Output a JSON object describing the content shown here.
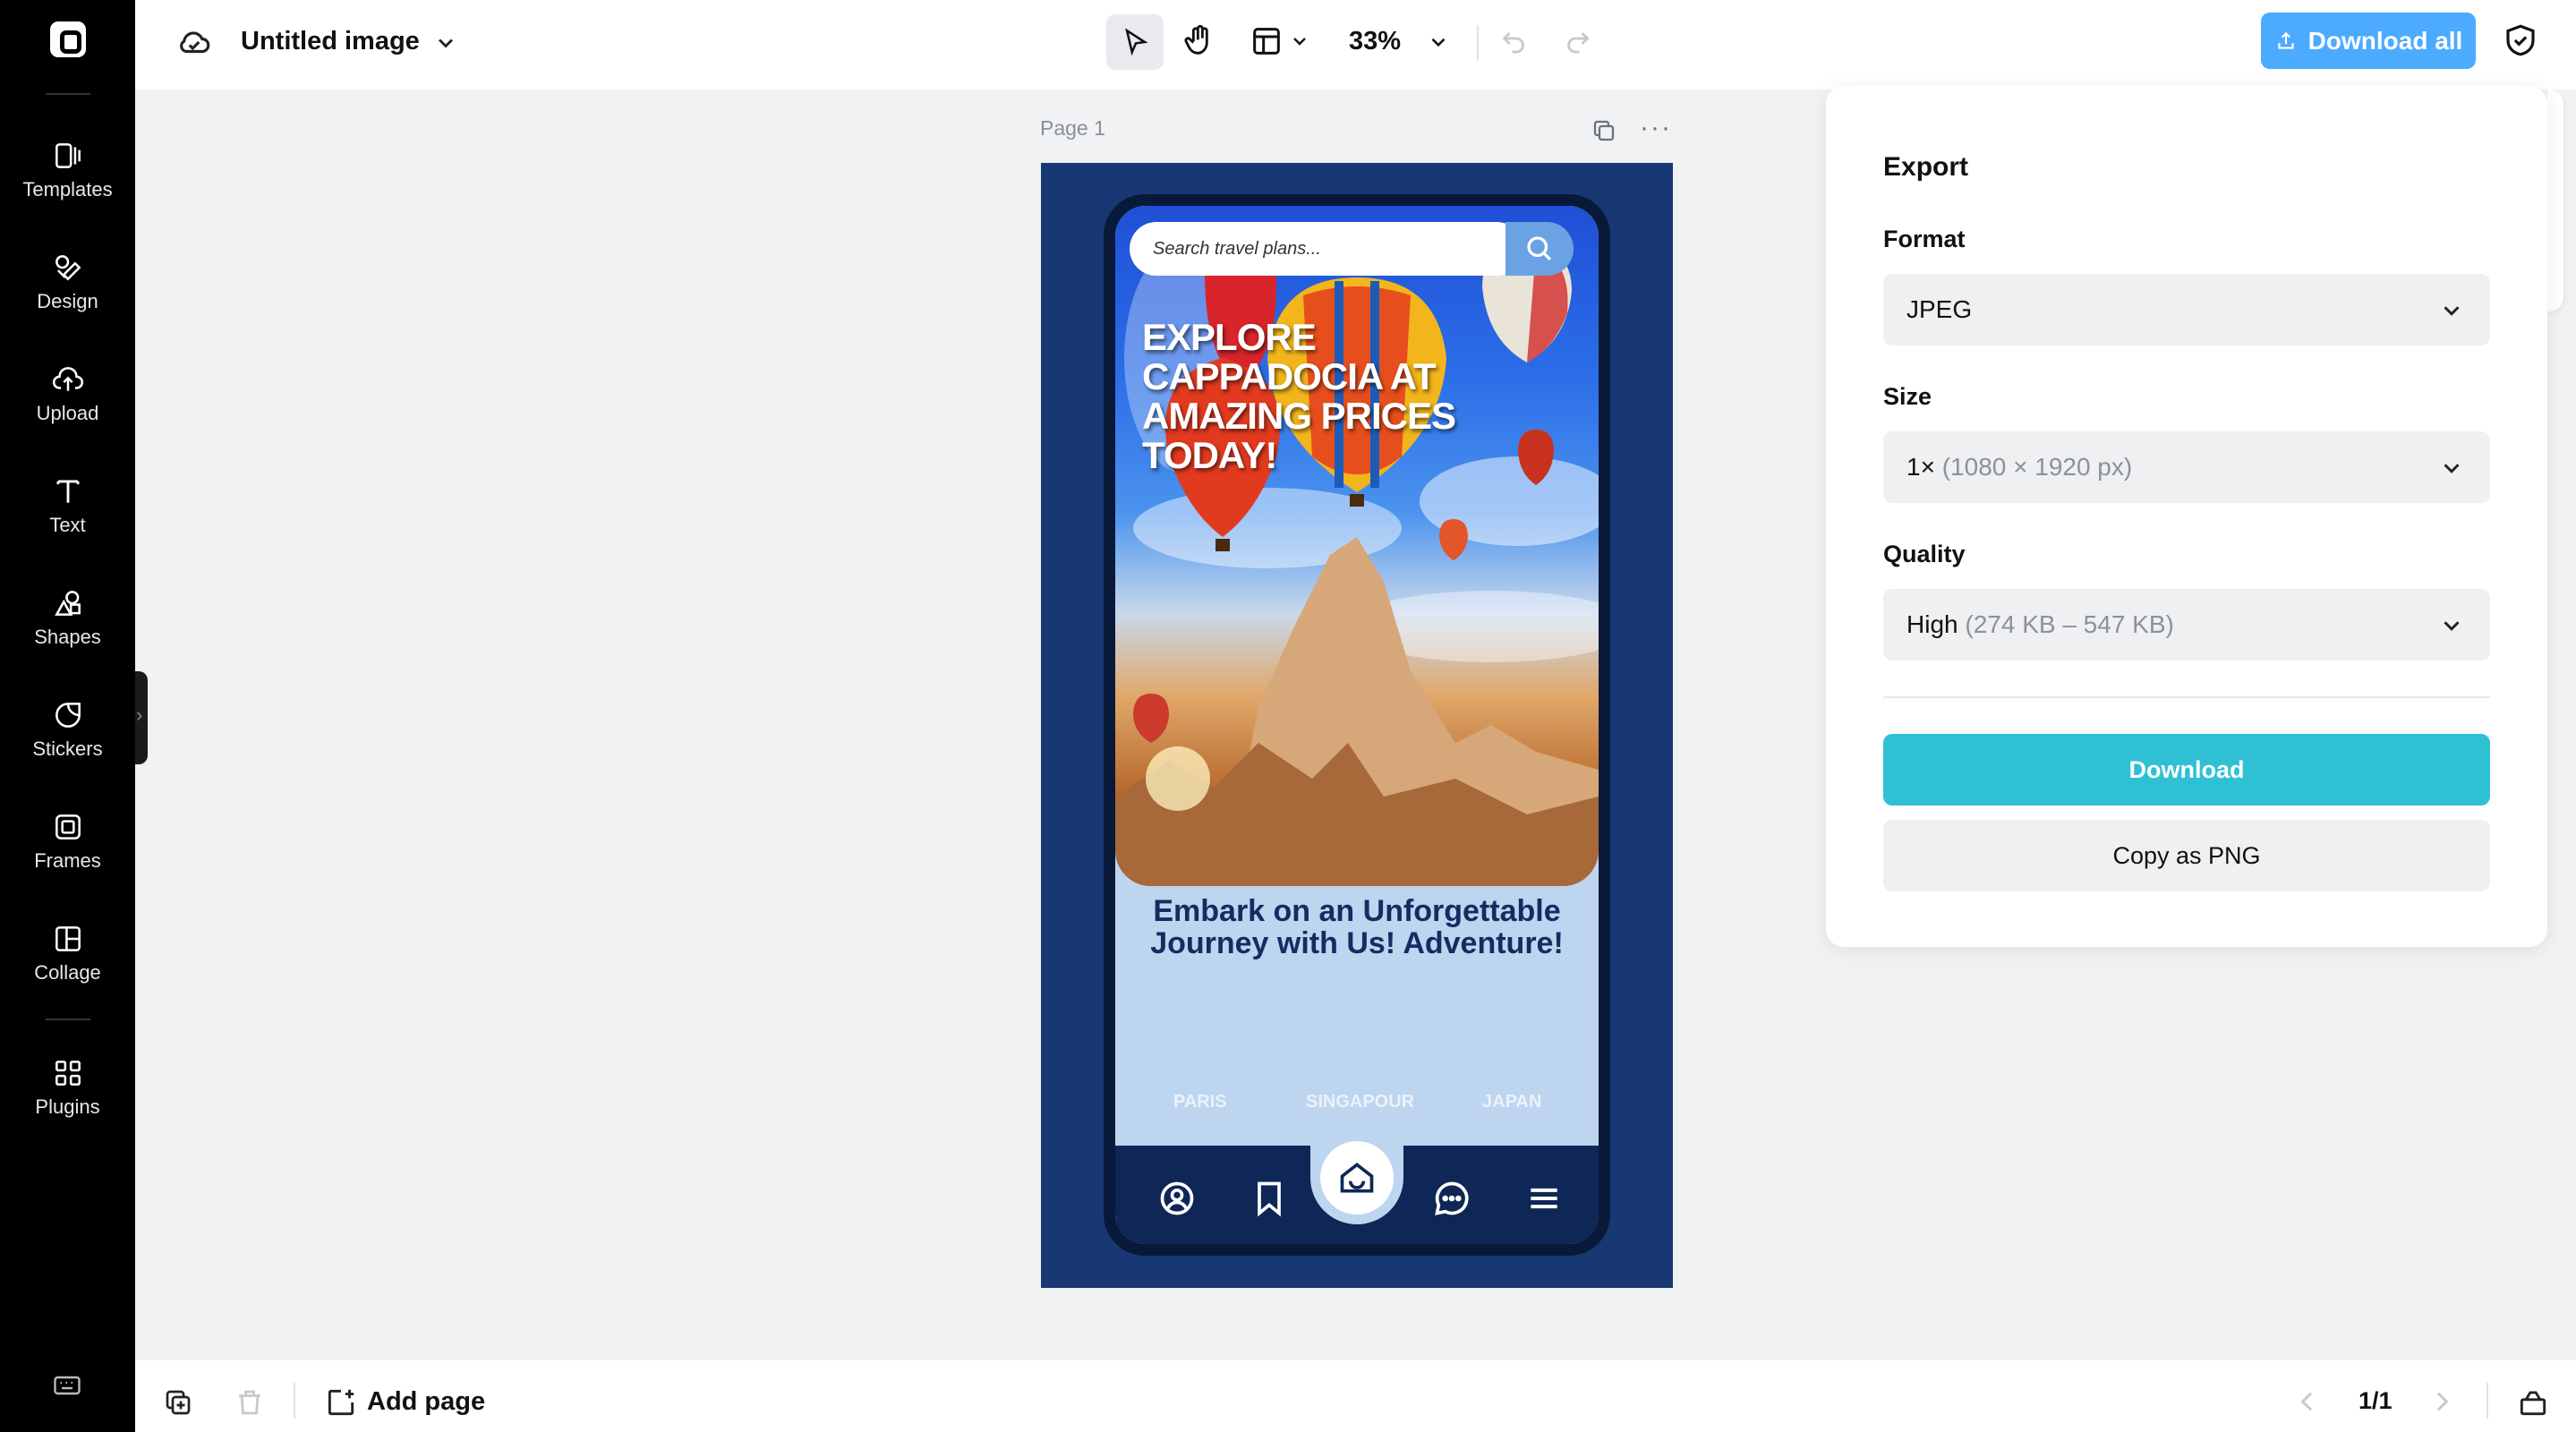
{
  "sidebar": {
    "items": [
      {
        "label": "Templates",
        "icon": "templates-icon"
      },
      {
        "label": "Design",
        "icon": "design-icon"
      },
      {
        "label": "Upload",
        "icon": "upload-icon"
      },
      {
        "label": "Text",
        "icon": "text-icon"
      },
      {
        "label": "Shapes",
        "icon": "shapes-icon"
      },
      {
        "label": "Stickers",
        "icon": "stickers-icon"
      },
      {
        "label": "Frames",
        "icon": "frames-icon"
      },
      {
        "label": "Collage",
        "icon": "collage-icon"
      },
      {
        "label": "Plugins",
        "icon": "plugins-icon"
      }
    ]
  },
  "header": {
    "file_title": "Untitled image",
    "zoom": "33%",
    "download_all_label": "Download all"
  },
  "canvas": {
    "page_label": "Page 1",
    "design": {
      "search_placeholder": "Search travel plans...",
      "headline": "EXPLORE CAPPADOCIA AT AMAZING PRICES TODAY!",
      "subtitle": "Embark on an Unforgettable Journey with Us! Adventure!",
      "destinations": [
        "PARIS",
        "SINGAPOUR",
        "JAPAN"
      ],
      "background_color": "#173872"
    }
  },
  "export": {
    "title": "Export",
    "format_label": "Format",
    "format_value": "JPEG",
    "size_label": "Size",
    "size_value": "1×",
    "size_detail": "(1080 × 1920 px)",
    "quality_label": "Quality",
    "quality_value": "High",
    "quality_detail": "(274 KB – 547 KB)",
    "download_label": "Download",
    "copy_label": "Copy as PNG",
    "accent_color": "#2fc0d4"
  },
  "footer": {
    "add_page_label": "Add page",
    "page_count": "1/1"
  },
  "colors": {
    "sidebar": "#000000",
    "download_all": "#2d9cff"
  }
}
